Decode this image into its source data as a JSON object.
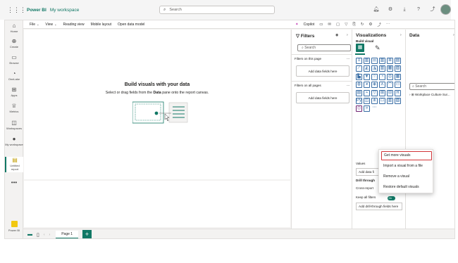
{
  "topbar": {
    "app_name": "Power BI",
    "workspace": "My workspace",
    "search_placeholder": "Search"
  },
  "leftnav": {
    "items": [
      {
        "label": "Home",
        "icon": "home-icon"
      },
      {
        "label": "Create",
        "icon": "plus-circle-icon"
      },
      {
        "label": "Browse",
        "icon": "folder-icon"
      },
      {
        "label": "OneLake",
        "icon": "onelake-icon"
      },
      {
        "label": "Apps",
        "icon": "apps-icon"
      },
      {
        "label": "Metrics",
        "icon": "trophy-icon"
      },
      {
        "label": "Workspaces",
        "icon": "workspaces-icon"
      },
      {
        "label": "My workspace",
        "icon": "workspace-avatar-icon"
      },
      {
        "label": "Untitled report",
        "icon": "report-icon"
      }
    ],
    "more": "•••",
    "footer_label": "Power BI"
  },
  "ribbon": {
    "items": [
      "File",
      "View",
      "Reading view",
      "Mobile layout",
      "Open data model"
    ],
    "copilot": "Copilot"
  },
  "canvas": {
    "title": "Build visuals with your data",
    "sub_before": "Select or drag fields from the ",
    "sub_bold": "Data",
    "sub_after": " pane onto the report canvas."
  },
  "pagebar": {
    "page_tab": "Page 1",
    "add": "+"
  },
  "filters": {
    "title": "Filters",
    "search_placeholder": "Search",
    "on_this_page": "Filters on this page",
    "on_all_pages": "Filters on all pages",
    "add_fields": "Add data fields here",
    "more": "..."
  },
  "viz": {
    "title": "Visualizations",
    "build_visual": "Build visual",
    "values_label": "Values",
    "values_add": "Add data fi",
    "drill_through": "Drill through",
    "cross_report": "Cross-report",
    "keep_all": "Keep all filters",
    "toggle": "On",
    "drill_add": "Add drill-through fields here"
  },
  "data": {
    "title": "Data",
    "search_placeholder": "Search",
    "table_item": "Workplace Culture Sur..."
  },
  "menu": {
    "items": [
      "Get more visuals",
      "Import a visual from a file",
      "Remove a visual",
      "Restore default visuals"
    ]
  },
  "colors": {
    "accent": "#117865",
    "highlight": "#d13438",
    "viz_icon": "#3a6ea5"
  }
}
